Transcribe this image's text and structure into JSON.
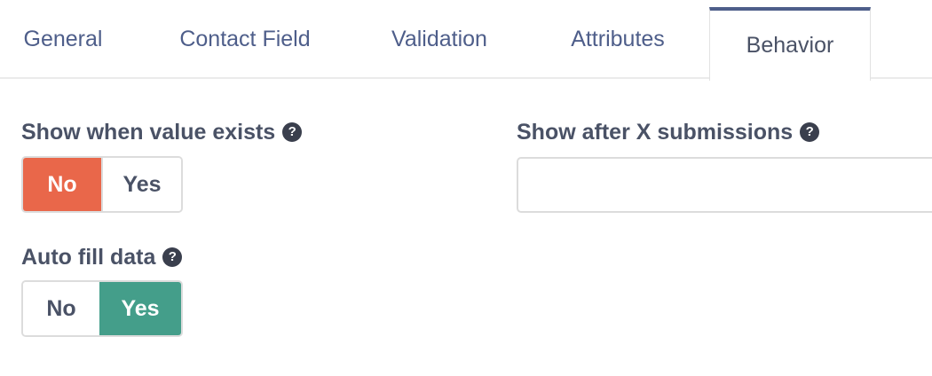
{
  "tabs": [
    {
      "label": "General",
      "active": false
    },
    {
      "label": "Contact Field",
      "active": false
    },
    {
      "label": "Validation",
      "active": false
    },
    {
      "label": "Attributes",
      "active": false
    },
    {
      "label": "Behavior",
      "active": true
    }
  ],
  "fields": {
    "show_when_value_exists": {
      "label": "Show when value exists",
      "help_icon": "question-circle-icon",
      "options": [
        "No",
        "Yes"
      ],
      "selected": "No"
    },
    "show_after_submissions": {
      "label": "Show after X submissions",
      "help_icon": "question-circle-icon",
      "value": "",
      "placeholder": ""
    },
    "auto_fill_data": {
      "label": "Auto fill data",
      "help_icon": "question-circle-icon",
      "options": [
        "No",
        "Yes"
      ],
      "selected": "Yes"
    }
  },
  "colors": {
    "tab_text": "#4e5e8a",
    "active_tab_border": "#4e5e8a",
    "toggle_no_active": "#e9674a",
    "toggle_yes_active": "#449e8a",
    "label_text": "#4a5266"
  },
  "help_glyph": "?"
}
